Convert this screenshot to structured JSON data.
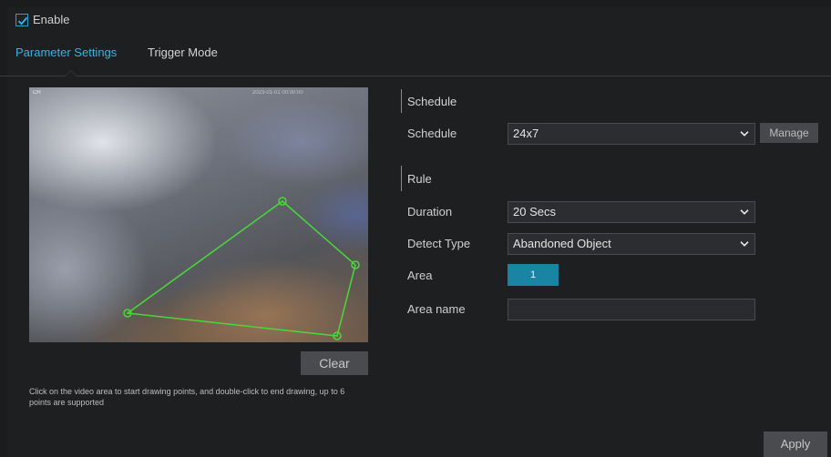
{
  "enable": {
    "label": "Enable",
    "checked": true
  },
  "tabs": [
    {
      "label": "Parameter Settings",
      "active": true
    },
    {
      "label": "Trigger Mode",
      "active": false
    }
  ],
  "video": {
    "channel_tag": "CH",
    "timestamp": "2023-01-01 00:00:00",
    "polygon_points_note": ""
  },
  "clear_button": "Clear",
  "hint_text": "Click on the video area to start drawing points, and double-click to end drawing, up to 6 points are supported",
  "schedule": {
    "section_title": "Schedule",
    "label": "Schedule",
    "value": "24x7",
    "manage_button": "Manage"
  },
  "rule": {
    "section_title": "Rule",
    "duration_label": "Duration",
    "duration_value": "20 Secs",
    "detect_type_label": "Detect Type",
    "detect_type_value": "Abandoned Object",
    "area_label": "Area",
    "area_button": "1",
    "area_name_label": "Area name",
    "area_name_value": ""
  },
  "apply_button": "Apply",
  "colors": {
    "accent": "#3ab4e0",
    "area_button": "#1a84a4",
    "polygon": "#49d83a",
    "background": "#1e1f21"
  }
}
